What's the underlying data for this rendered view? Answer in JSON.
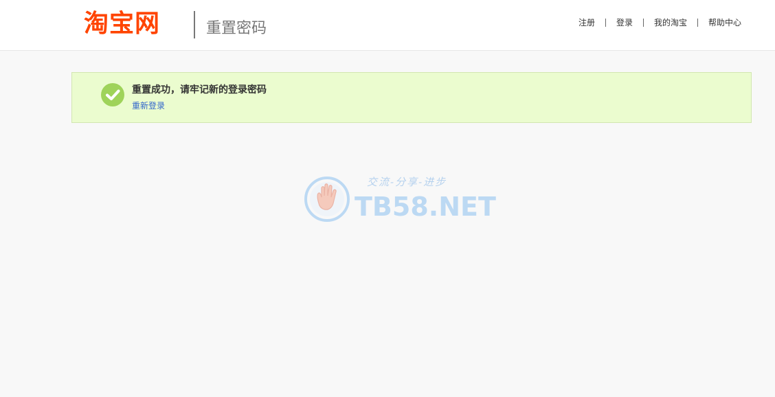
{
  "header": {
    "logo_text": "淘宝网",
    "page_heading": "重置密码",
    "nav": [
      {
        "label": "注册"
      },
      {
        "label": "登录"
      },
      {
        "label": "我的淘宝"
      },
      {
        "label": "帮助中心"
      }
    ]
  },
  "message": {
    "title": "重置成功，请牢记新的登录密码",
    "relogin_link": "重新登录",
    "icon": "check-circle-icon"
  },
  "watermark": {
    "slogan": "交流-分享-进步",
    "name": "TB58.NET"
  },
  "colors": {
    "brand": "#ff4400",
    "success_bg": "#ebfccf",
    "success_icon": "#9fd35a",
    "link": "#3366cc"
  }
}
